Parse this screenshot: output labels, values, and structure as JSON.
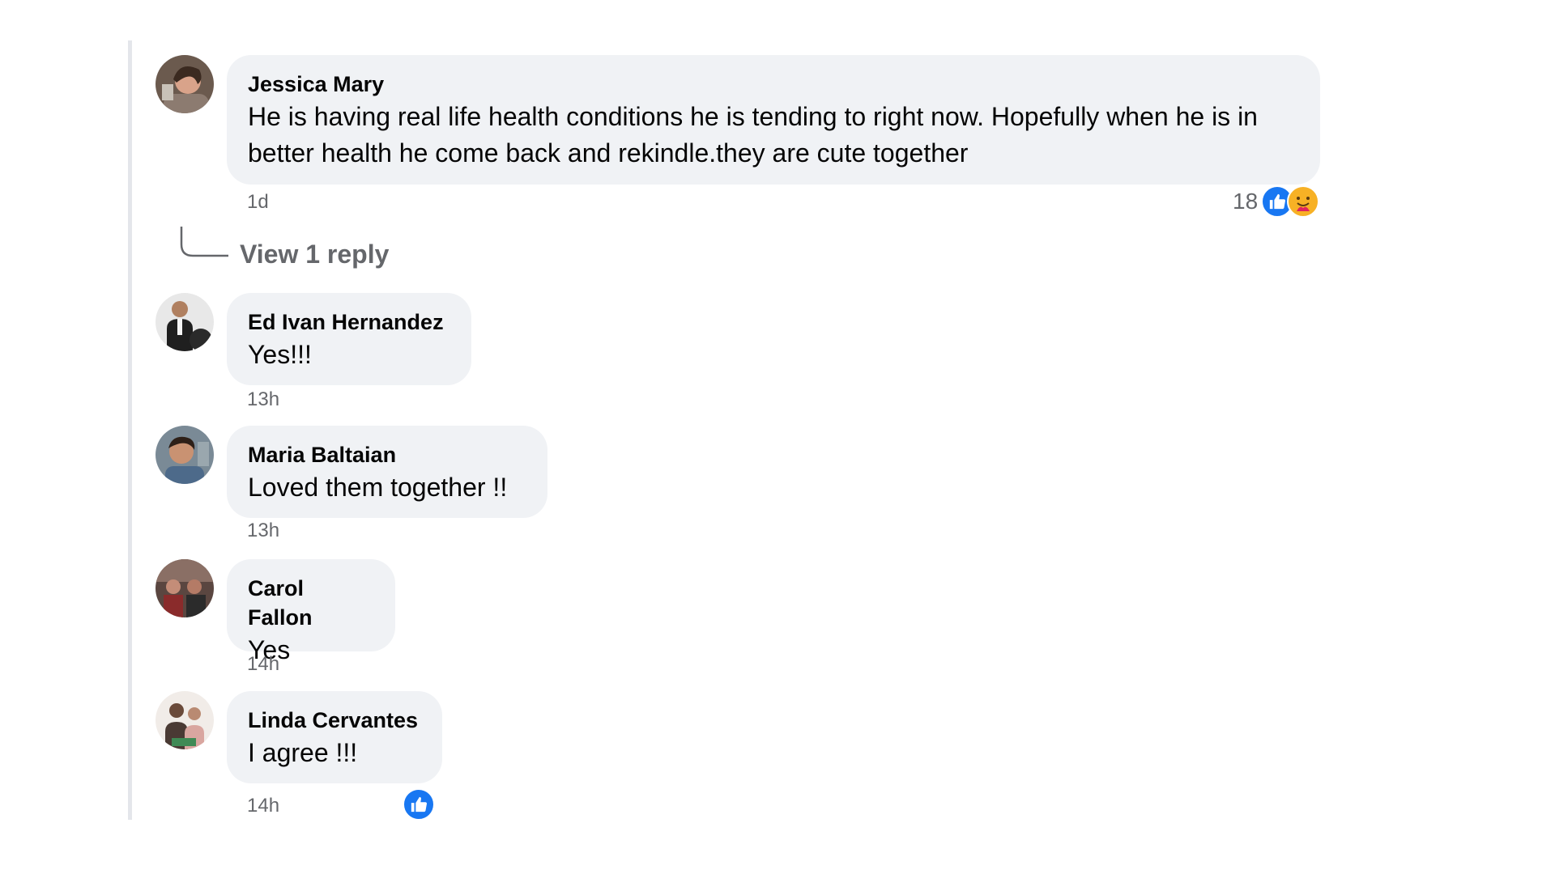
{
  "colors": {
    "bubble": "#f0f2f5",
    "meta_text": "#65676b",
    "like_blue": "#1877f2",
    "care_yellow": "#f7b125"
  },
  "comments": [
    {
      "author": "Jessica Mary",
      "text": "He is having real life health conditions he is tending to right now. Hopefully when he is in better health he come back and rekindle.they are cute together",
      "time": "1d",
      "reaction_count": "18",
      "reactions": [
        "like-icon",
        "care-icon"
      ],
      "reply_link": "View 1 reply"
    },
    {
      "author": "Ed Ivan Hernandez",
      "text": "Yes!!!",
      "time": "13h"
    },
    {
      "author": "Maria Baltaian",
      "text": "Loved them together !!",
      "time": "13h"
    },
    {
      "author": "Carol Fallon",
      "text": "Yes",
      "time": "14h"
    },
    {
      "author": "Linda Cervantes",
      "text": "I agree !!!",
      "time": "14h",
      "reactions": [
        "like-icon"
      ]
    }
  ]
}
